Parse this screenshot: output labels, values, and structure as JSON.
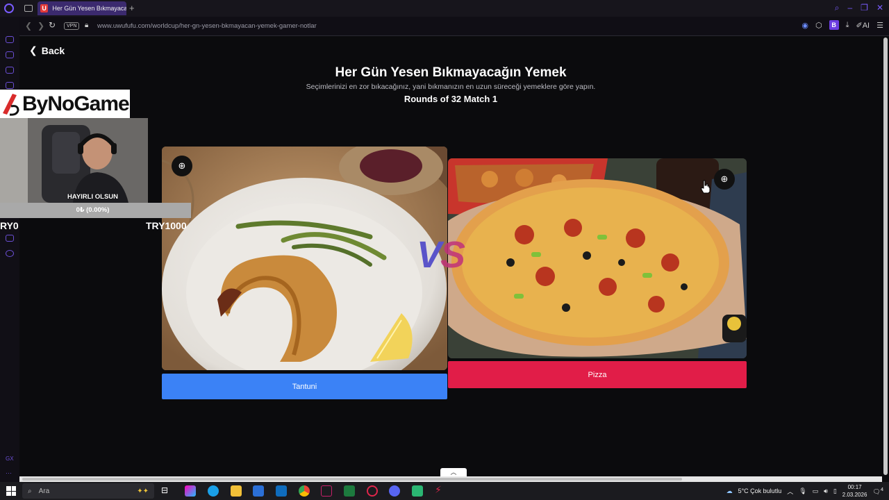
{
  "browser": {
    "tab_title": "Her Gün Yesen Bıkmayacağ",
    "tab_favicon": "U",
    "url": "www.uwufufu.com/worldcup/her-gn-yesen-bkmayacan-yemek-gamer-notlar",
    "vpn_label": "VPN",
    "ext_b": "B",
    "ai_label": "AI"
  },
  "page": {
    "back_label": "Back",
    "title": "Her Gün Yesen Bıkmayacağın Yemek",
    "subtitle": "Seçimlerinizi en zor bıkacağınız, yani bıkmanızın en uzun süreceği yemeklere göre yapın.",
    "round_info": "Rounds of 32 Match 1",
    "vs": [
      "V",
      "S"
    ],
    "left_choice": "Tantuni",
    "right_choice": "Pizza"
  },
  "overlay": {
    "sponsor": "ByNoGame",
    "donation_title": "HAYIRLI OLSUN",
    "progress_label": "0₺ (0.00%)",
    "progress_fraction": 0.0,
    "goal_min": "RY0",
    "goal_max": "TRY1000"
  },
  "taskbar": {
    "search_placeholder": "Ara",
    "weather": "5°C  Çok bulutlu",
    "time": "00:17",
    "date": "2.03.2026",
    "notification_count": "4"
  },
  "colors": {
    "accent": "#7a5cff",
    "left_button": "#3b82f6",
    "right_button": "#e11d48"
  }
}
